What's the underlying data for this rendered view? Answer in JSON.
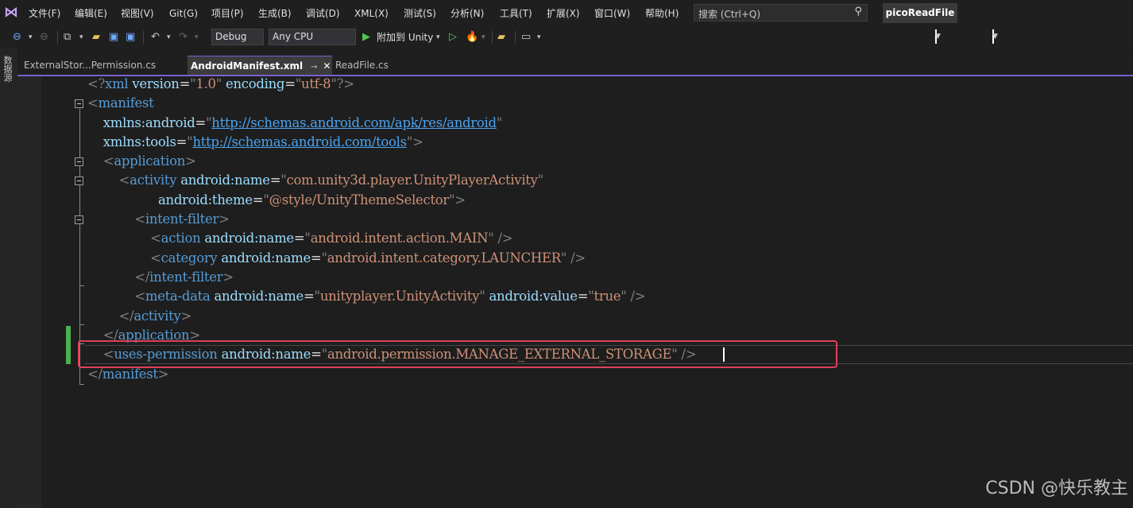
{
  "menubar": {
    "items": [
      "文件(F)",
      "编辑(E)",
      "视图(V)",
      "Git(G)",
      "项目(P)",
      "生成(B)",
      "调试(D)",
      "XML(X)",
      "测试(S)",
      "分析(N)",
      "工具(T)",
      "扩展(X)",
      "窗口(W)",
      "帮助(H)"
    ],
    "search_placeholder": "搜索 (Ctrl+Q)",
    "solution_name": "picoReadFile"
  },
  "toolbar": {
    "configuration": "Debug",
    "platform": "Any CPU",
    "attach_label": "附加到 Unity"
  },
  "left_strip": {
    "label": "数据源"
  },
  "tabs": [
    {
      "label": "ExternalStor...Permission.cs"
    },
    {
      "label": "AndroidManifest.xml"
    },
    {
      "label": "ReadFile.cs"
    }
  ],
  "editor": {
    "lines": [
      "<?xml version=\"1.0\" encoding=\"utf-8\"?>",
      "<manifest",
      "    xmlns:android=\"http://schemas.android.com/apk/res/android\"",
      "    xmlns:tools=\"http://schemas.android.com/tools\">",
      "    <application>",
      "        <activity android:name=\"com.unity3d.player.UnityPlayerActivity\"",
      "                  android:theme=\"@style/UnityThemeSelector\">",
      "            <intent-filter>",
      "                <action android:name=\"android.intent.action.MAIN\" />",
      "                <category android:name=\"android.intent.category.LAUNCHER\" />",
      "            </intent-filter>",
      "            <meta-data android:name=\"unityplayer.UnityActivity\" android:value=\"true\" />",
      "        </activity>",
      "    </application>",
      "    <uses-permission android:name=\"android.permission.MANAGE_EXTERNAL_STORAGE\" />",
      "</manifest>"
    ]
  },
  "watermark": "CSDN @快乐教主",
  "colors": {
    "tag": "#569cd6",
    "attribute": "#9cdcfe",
    "string": "#ce9178",
    "punctuation": "#808080",
    "link": "#4aa3f0",
    "highlight_border": "#e0405a",
    "change_marker": "#4caf50",
    "tab_accent": "#7a5fd0"
  }
}
